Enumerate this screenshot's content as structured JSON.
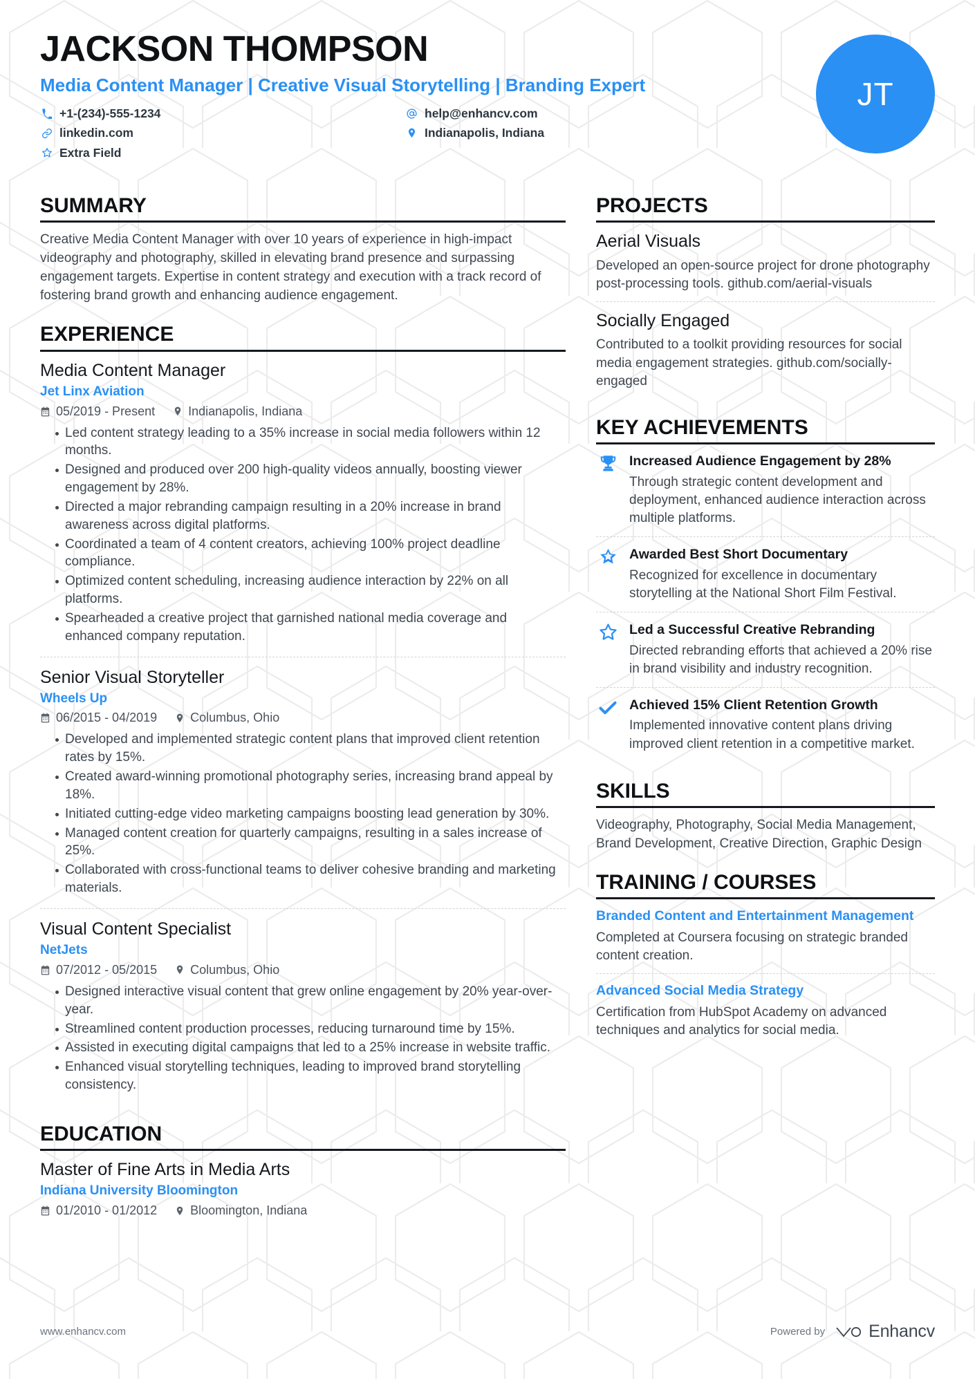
{
  "colors": {
    "accent": "#2a90f4",
    "text": "#2d3640",
    "muted": "#3f4750",
    "rule": "#15191e",
    "watermark": "#ececec"
  },
  "header": {
    "name": "JACKSON THOMPSON",
    "headline": "Media Content Manager | Creative Visual Storytelling | Branding Expert",
    "avatar_initials": "JT",
    "contacts": [
      {
        "icon": "phone-icon",
        "value": "+1-(234)-555-1234"
      },
      {
        "icon": "at-icon",
        "value": "help@enhancv.com"
      },
      {
        "icon": "link-icon",
        "value": "linkedin.com"
      },
      {
        "icon": "location-icon",
        "value": "Indianapolis, Indiana"
      },
      {
        "icon": "star-icon",
        "value": "Extra Field"
      }
    ]
  },
  "summary": {
    "title": "SUMMARY",
    "text": "Creative Media Content Manager with over 10 years of experience in high-impact videography and photography, skilled in elevating brand presence and surpassing engagement targets. Expertise in content strategy and execution with a track record of fostering brand growth and enhancing audience engagement."
  },
  "experience": {
    "title": "EXPERIENCE",
    "entries": [
      {
        "role": "Media Content Manager",
        "company": "Jet Linx Aviation",
        "dates": "05/2019 - Present",
        "location": "Indianapolis, Indiana",
        "bullets": [
          "Led content strategy leading to a 35% increase in social media followers within 12 months.",
          "Designed and produced over 200 high-quality videos annually, boosting viewer engagement by 28%.",
          "Directed a major rebranding campaign resulting in a 20% increase in brand awareness across digital platforms.",
          "Coordinated a team of 4 content creators, achieving 100% project deadline compliance.",
          "Optimized content scheduling, increasing audience interaction by 22% on all platforms.",
          "Spearheaded a creative project that garnished national media coverage and enhanced company reputation."
        ]
      },
      {
        "role": "Senior Visual Storyteller",
        "company": "Wheels Up",
        "dates": "06/2015 - 04/2019",
        "location": "Columbus, Ohio",
        "bullets": [
          "Developed and implemented strategic content plans that improved client retention rates by 15%.",
          "Created award-winning promotional photography series, increasing brand appeal by 18%.",
          "Initiated cutting-edge video marketing campaigns boosting lead generation by 30%.",
          "Managed content creation for quarterly campaigns, resulting in a sales increase of 25%.",
          "Collaborated with cross-functional teams to deliver cohesive branding and marketing materials."
        ]
      },
      {
        "role": "Visual Content Specialist",
        "company": "NetJets",
        "dates": "07/2012 - 05/2015",
        "location": "Columbus, Ohio",
        "bullets": [
          "Designed interactive visual content that grew online engagement by 20% year-over-year.",
          "Streamlined content production processes, reducing turnaround time by 15%.",
          "Assisted in executing digital campaigns that led to a 25% increase in website traffic.",
          "Enhanced visual storytelling techniques, leading to improved brand storytelling consistency."
        ]
      }
    ]
  },
  "education": {
    "title": "EDUCATION",
    "entries": [
      {
        "degree": "Master of Fine Arts in Media Arts",
        "school": "Indiana University Bloomington",
        "dates": "01/2010 - 01/2012",
        "location": "Bloomington, Indiana"
      }
    ]
  },
  "projects": {
    "title": "PROJECTS",
    "entries": [
      {
        "name": "Aerial Visuals",
        "description": "Developed an open-source project for drone photography post-processing tools. github.com/aerial-visuals"
      },
      {
        "name": "Socially Engaged",
        "description": "Contributed to a toolkit providing resources for social media engagement strategies. github.com/socially-engaged"
      }
    ]
  },
  "achievements": {
    "title": "KEY ACHIEVEMENTS",
    "entries": [
      {
        "icon": "trophy-icon",
        "title": "Increased Audience Engagement by 28%",
        "description": "Through strategic content development and deployment, enhanced audience interaction across multiple platforms."
      },
      {
        "icon": "star-filled-icon",
        "title": "Awarded Best Short Documentary",
        "description": "Recognized for excellence in documentary storytelling at the National Short Film Festival."
      },
      {
        "icon": "star-outline-icon",
        "title": "Led a Successful Creative Rebranding",
        "description": "Directed rebranding efforts that achieved a 20% rise in brand visibility and industry recognition."
      },
      {
        "icon": "check-icon",
        "title": "Achieved 15% Client Retention Growth",
        "description": "Implemented innovative content plans driving improved client retention in a competitive market."
      }
    ]
  },
  "skills": {
    "title": "SKILLS",
    "text": "Videography, Photography, Social Media Management, Brand Development, Creative Direction, Graphic Design"
  },
  "training": {
    "title": "TRAINING / COURSES",
    "entries": [
      {
        "name": "Branded Content and Entertainment Management",
        "description": "Completed at Coursera focusing on strategic branded content creation."
      },
      {
        "name": "Advanced Social Media Strategy",
        "description": "Certification from HubSpot Academy on advanced techniques and analytics for social media."
      }
    ]
  },
  "footer": {
    "url": "www.enhancv.com",
    "powered_by": "Powered by",
    "brand": "Enhancv"
  }
}
